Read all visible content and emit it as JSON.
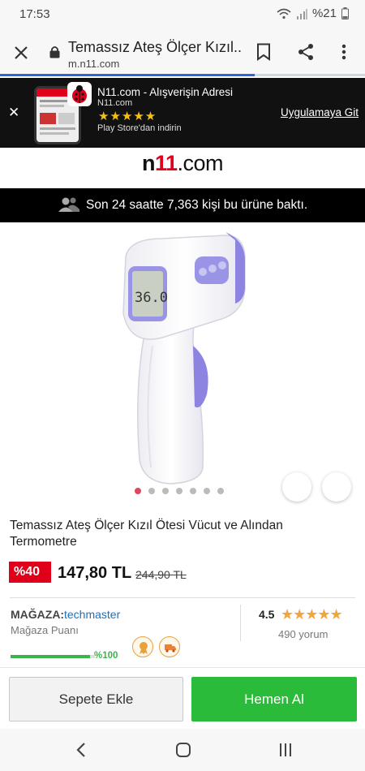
{
  "status_bar": {
    "time": "17:53",
    "battery": "%21"
  },
  "browser": {
    "page_title": "Temassız Ateş Ölçer Kızıl...",
    "url": "m.n11.com"
  },
  "app_banner": {
    "title": "N11.com - Alışverişin Adresi",
    "publisher": "N11.com",
    "stars": "★★★★★",
    "store_text": "Play Store'dan indirin",
    "cta": "Uygulamaya Git"
  },
  "logo": {
    "brand_a": "n",
    "brand_b": "11",
    "brand_c": ".com"
  },
  "viewers": {
    "text": "Son 24 saatte 7,363 kişi bu ürüne baktı."
  },
  "product": {
    "image_display": "36.0",
    "image_dots_total": 7,
    "image_dots_active": 1,
    "title": "Temassız Ateş Ölçer Kızıl Ötesi Vücut ve Alından Termometre",
    "discount": "%40",
    "price": "147,80 TL",
    "old_price": "244,90 TL"
  },
  "store": {
    "label": "MAĞAZA:",
    "name": "techmaster",
    "score_label": "Mağaza Puanı",
    "score_pct": "%100",
    "score_value": 1.0,
    "rating": "4.5",
    "rating_stars": "★★★★★",
    "reviews": "490 yorum"
  },
  "actions": {
    "cart": "Sepete Ekle",
    "buy": "Hemen Al"
  },
  "colors": {
    "brand_red": "#e0001a",
    "buy_green": "#2bbb3a",
    "link_blue": "#1a6fc4",
    "star_orange": "#f2a53c"
  }
}
